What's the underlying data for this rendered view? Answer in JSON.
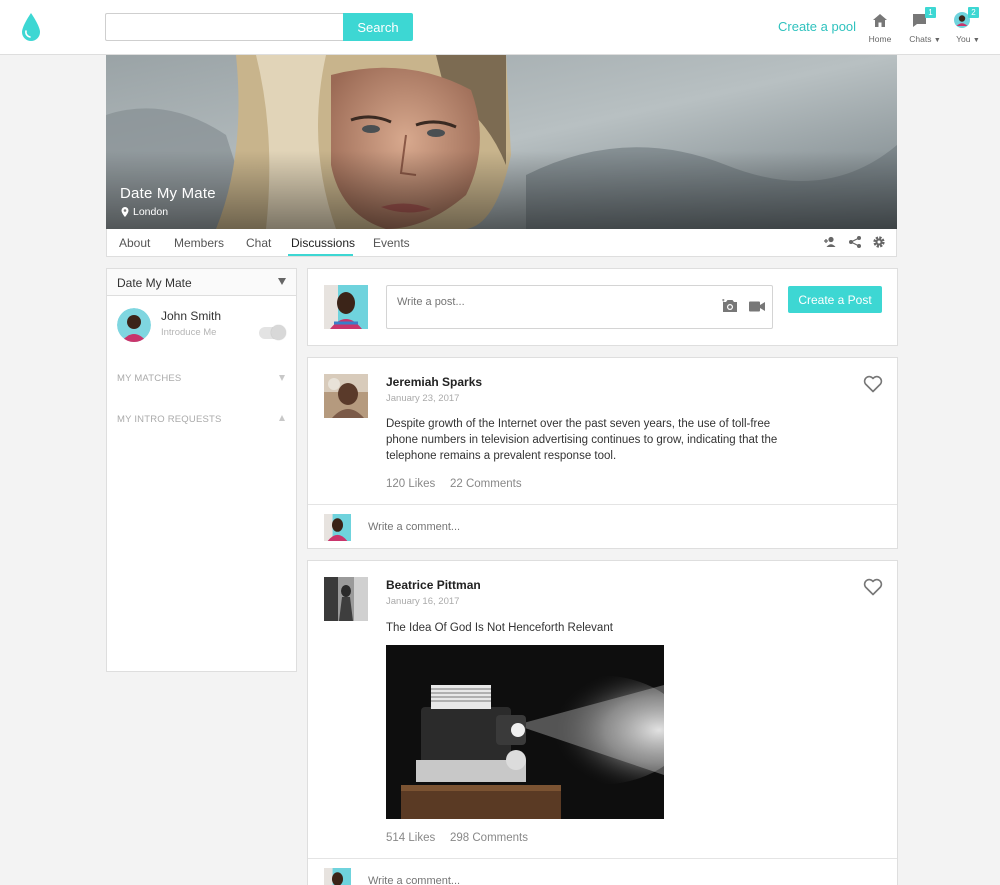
{
  "header": {
    "search": {
      "placeholder": "",
      "button_label": "Search"
    },
    "create_pool_label": "Create a pool",
    "nav": [
      {
        "label": "Home"
      },
      {
        "label": "Chats",
        "badge": "1"
      },
      {
        "label": "You",
        "badge": "2"
      }
    ]
  },
  "cover": {
    "title": "Date My Mate",
    "location": "London"
  },
  "tabs": [
    {
      "label": "About"
    },
    {
      "label": "Members"
    },
    {
      "label": "Chat"
    },
    {
      "label": "Discussions",
      "active": true
    },
    {
      "label": "Events"
    }
  ],
  "sidebar": {
    "dropdown_label": "Date My Mate",
    "user": {
      "name": "John Smith",
      "subtitle": "Introduce Me",
      "toggle_on": false
    },
    "sections": [
      {
        "label": "MY MATCHES"
      },
      {
        "label": "MY INTRO REQUESTS"
      }
    ]
  },
  "composer": {
    "placeholder": "Write a post...",
    "button_label": "Create a Post"
  },
  "posts": [
    {
      "author": "Jeremiah Sparks",
      "date": "January 23, 2017",
      "body": "Despite growth of the Internet over the past seven years, the use of toll-free phone numbers in television advertising continues to grow, indicating that the telephone remains a prevalent response tool.",
      "likes": "120 Likes",
      "comments": "22 Comments",
      "comment_placeholder": "Write a comment..."
    },
    {
      "author": "Beatrice Pittman",
      "date": "January 16, 2017",
      "body": "The Idea Of God Is Not Henceforth Relevant",
      "likes": "514 Likes",
      "comments": "298 Comments",
      "comment_placeholder": "Write a comment..."
    }
  ],
  "colors": {
    "accent": "#3dd7d3",
    "accent_text": "#2fc2be",
    "background": "#f3f3f3"
  }
}
